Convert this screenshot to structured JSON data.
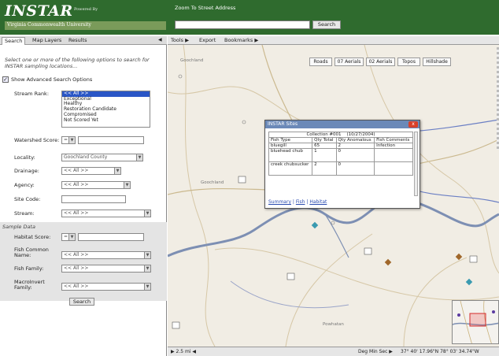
{
  "header": {
    "logo": "INSTAR",
    "powered_by": "Powered By",
    "sub": "Virginia Commonwealth University",
    "zoom_label": "Zoom To Street Address",
    "zoom_button": "Search"
  },
  "left_tabs": [
    "Search",
    "Map Layers",
    "Results"
  ],
  "search": {
    "intro": "Select one or more of the following options to search for INSTAR sampling locations...",
    "show_advanced": "Show Advanced Search Options",
    "stream_rank_label": "Stream Rank:",
    "stream_rank_options": [
      "<< All >>",
      "Exceptional",
      "Healthy",
      "Restoration Candidate",
      "Compromised",
      "Not Scored Yet"
    ],
    "watershed_label": "Watershed Score:",
    "watershed_value": "= ",
    "locality_label": "Locality:",
    "locality_value": "Goochland County",
    "drainage_label": "Drainage:",
    "drainage_value": "<< All >>",
    "agency_label": "Agency:",
    "agency_value": "<< All >>",
    "site_code_label": "Site Code:",
    "stream_label": "Stream:",
    "stream_value": "<< All >>"
  },
  "sample": {
    "title": "Sample Data",
    "habitat_label": "Habitat Score:",
    "habitat_value": "= ",
    "fish_common_label": "Fish Common Name:",
    "fish_common_value": "<< All >>",
    "fish_family_label": "Fish Family:",
    "fish_family_value": "<< All >>",
    "macro_label": "MacroInvert Family:",
    "macro_value": "<< All >>",
    "search_button": "Search"
  },
  "map_toolbar": [
    "Tools ▶",
    "Export",
    "Bookmarks ▶"
  ],
  "layer_buttons": [
    "Roads",
    "07 Aerials",
    "02 Aerials",
    "Topos",
    "Hillshade"
  ],
  "towns": [
    "Goochland",
    "Goochland",
    "Powhatan"
  ],
  "popup": {
    "title": "INSTAR Sites",
    "collection": "Collection #001",
    "date": "(10/27/2004)",
    "headers": [
      "Fish Type",
      "Qty Total",
      "Qty Anomalous",
      "Fish Comments"
    ],
    "rows": [
      [
        "bluegill",
        "65",
        "2",
        "Infection"
      ],
      [
        "bluehead chub",
        "1",
        "0",
        ""
      ],
      [
        "creek chubsucker",
        "2",
        "0",
        ""
      ]
    ],
    "links": [
      "Summary",
      "Fish",
      "Habitat"
    ],
    "close": "x"
  },
  "status": {
    "scale": "▶ 2.5 mi  ◀",
    "coord_mode": "Deg Min Sec ▶",
    "coords": "37° 40' 17.96\"N   78° 03' 34.74\"W"
  }
}
